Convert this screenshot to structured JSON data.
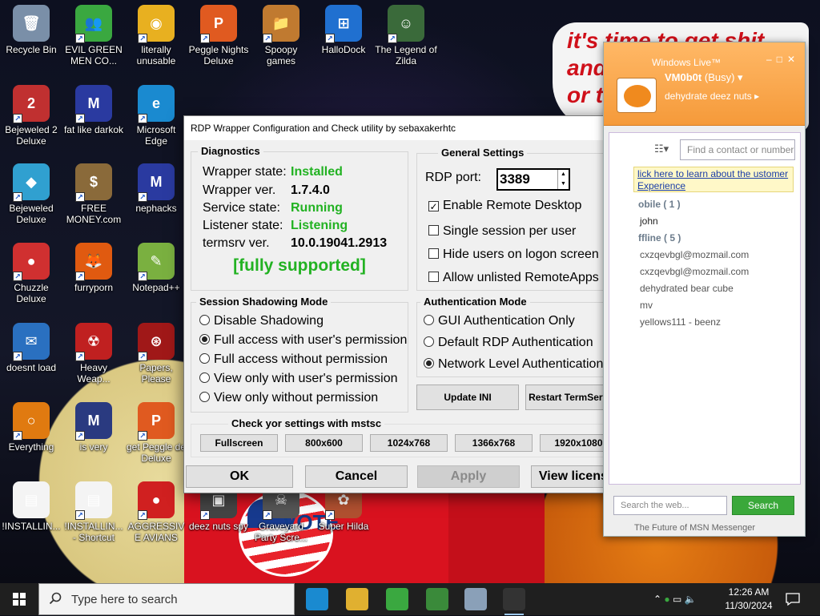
{
  "desktop": {
    "banner_text": "it's time to get shit\nand\nor t",
    "vote_text": "VOTE",
    "icons": [
      {
        "label": "Recycle Bin",
        "color": "#7a8fa8",
        "glyph": "🗑"
      },
      {
        "label": "EVIL GREEN MEN CO...",
        "color": "#3aa840",
        "glyph": "👥"
      },
      {
        "label": "literally unusable",
        "color": "#e8b020",
        "glyph": "◉"
      },
      {
        "label": "Peggle Nights Deluxe",
        "color": "#e05a20",
        "glyph": "P"
      },
      {
        "label": "Spoopy games",
        "color": "#c07a30",
        "glyph": "📁"
      },
      {
        "label": "HalloDock",
        "color": "#2070d0",
        "glyph": "⊞"
      },
      {
        "label": "The Legend of Zilda",
        "color": "#3a6a3a",
        "glyph": "☺"
      },
      {
        "label": "Bejeweled 2 Deluxe",
        "color": "#c03030",
        "glyph": "2"
      },
      {
        "label": "fat like darkok",
        "color": "#2a3aa0",
        "glyph": "M"
      },
      {
        "label": "Microsoft Edge",
        "color": "#1a8ad0",
        "glyph": "e"
      },
      {
        "label": "Bejeweled Deluxe",
        "color": "#30a0d0",
        "glyph": "◆"
      },
      {
        "label": "FREE MONEY.com",
        "color": "#8a6a3a",
        "glyph": "$"
      },
      {
        "label": "nephacks",
        "color": "#2a3aa0",
        "glyph": "M"
      },
      {
        "label": "Chuzzle Deluxe",
        "color": "#d03030",
        "glyph": "●"
      },
      {
        "label": "furryporn",
        "color": "#e05a10",
        "glyph": "🦊"
      },
      {
        "label": "Notepad++",
        "color": "#7ab040",
        "glyph": "✎"
      },
      {
        "label": "doesnt load",
        "color": "#2a70c0",
        "glyph": "✉"
      },
      {
        "label": "Heavy Weap...",
        "color": "#c02020",
        "glyph": "☢"
      },
      {
        "label": "Papers, Please",
        "color": "#a01818",
        "glyph": "⊛"
      },
      {
        "label": "Everything",
        "color": "#e07a10",
        "glyph": "○"
      },
      {
        "label": "is very",
        "color": "#2a3a80",
        "glyph": "M"
      },
      {
        "label": "get Peggle de Deluxe",
        "color": "#e05a20",
        "glyph": "P"
      },
      {
        "label": "!INSTALLIN...",
        "color": "#f4f4f4",
        "glyph": "▤"
      },
      {
        "label": "!INSTALLIN... - Shortcut",
        "color": "#f4f4f4",
        "glyph": "▤"
      },
      {
        "label": "AGGRESSIVE AVIANS",
        "color": "#d02020",
        "glyph": "●"
      },
      {
        "label": "deez nuts spy",
        "color": "#444444",
        "glyph": "▣"
      },
      {
        "label": "Graveyard Party Scre...",
        "color": "#555555",
        "glyph": "☠"
      },
      {
        "label": "Super Hilda",
        "color": "#b05030",
        "glyph": "✿"
      }
    ]
  },
  "rdp": {
    "title": "RDP Wrapper Configuration and Check utility by sebaxakerhtc",
    "close": "✕",
    "diagnostics": {
      "title": "Diagnostics",
      "rows": [
        {
          "key": "Wrapper state:",
          "value": "Installed",
          "green": true
        },
        {
          "key": "Wrapper ver.",
          "value": "1.7.4.0",
          "green": false
        },
        {
          "key": "Service state:",
          "value": "Running",
          "green": true
        },
        {
          "key": "Listener state:",
          "value": "Listening",
          "green": true
        },
        {
          "key": "termsrv ver.",
          "value": "10.0.19041.2913",
          "green": false
        }
      ],
      "support": "[fully supported]"
    },
    "general": {
      "title": "General Settings",
      "port_label": "RDP port:",
      "port_value": "3389",
      "options": [
        {
          "label": "Enable Remote Desktop",
          "checked": true
        },
        {
          "label": "Single session per user",
          "checked": false
        },
        {
          "label": "Hide users on logon screen",
          "checked": false
        },
        {
          "label": "Allow unlisted RemoteApps",
          "checked": false
        }
      ]
    },
    "shadow": {
      "title": "Session Shadowing Mode",
      "options": [
        {
          "label": "Disable Shadowing",
          "selected": false
        },
        {
          "label": "Full access with user's permission",
          "selected": true
        },
        {
          "label": "Full access without permission",
          "selected": false
        },
        {
          "label": "View only with user's permission",
          "selected": false
        },
        {
          "label": "View only without permission",
          "selected": false
        }
      ]
    },
    "auth": {
      "title": "Authentication Mode",
      "options": [
        {
          "label": "GUI Authentication Only",
          "selected": false
        },
        {
          "label": "Default RDP Authentication",
          "selected": false
        },
        {
          "label": "Network Level Authentication",
          "selected": true
        }
      ]
    },
    "update_ini": "Update INI",
    "restart": "Restart TermService",
    "mstsc": {
      "title": "Check yor settings with mstsc",
      "buttons": [
        "Fullscreen",
        "800x600",
        "1024x768",
        "1366x768",
        "1920x1080"
      ]
    },
    "ok": "OK",
    "cancel": "Cancel",
    "apply": "Apply",
    "license": "View license..."
  },
  "msn": {
    "title": "Windows Live™",
    "win_buttons": "–□✕",
    "name": "VM0b0t",
    "status": "(Busy) ▾",
    "psm": "dehydrate deez nuts ▸",
    "search_placeholder": "Find a contact or number",
    "banner": "lick here to learn about the ustomer Experience",
    "rows": [
      {
        "text": "obile ( 1 )",
        "kind": "group-h"
      },
      {
        "text": "john",
        "kind": "online"
      },
      {
        "text": "ffline ( 5 )",
        "kind": "group-h"
      },
      {
        "text": "cxzqevbgl@mozmail.com",
        "kind": "offline"
      },
      {
        "text": "cxzqevbgl@mozmail.com",
        "kind": "offline"
      },
      {
        "text": "dehydrated bear cube",
        "kind": "offline"
      },
      {
        "text": "mv",
        "kind": "offline"
      },
      {
        "text": "yellows111 - beenz",
        "kind": "offline"
      }
    ],
    "web_search_placeholder": "Search the web...",
    "search_button": "Search",
    "tagline": "The Future of MSN Messenger"
  },
  "taskbar": {
    "search_placeholder": "Type here to search",
    "time": "12:26 AM",
    "date": "11/30/2024",
    "apps": [
      {
        "name": "edge",
        "color": "#1a8ad0"
      },
      {
        "name": "file-explorer",
        "color": "#e0b030"
      },
      {
        "name": "messenger",
        "color": "#3aa840"
      },
      {
        "name": "terminal-green",
        "color": "#3a8a3a"
      },
      {
        "name": "monitor-app",
        "color": "#8aa0b8"
      },
      {
        "name": "rdp-config",
        "color": "#333333"
      }
    ]
  },
  "colors": {
    "green": "#22b222",
    "msn_orange": "#f59a3a",
    "taskbar": "#1f1f1f"
  }
}
